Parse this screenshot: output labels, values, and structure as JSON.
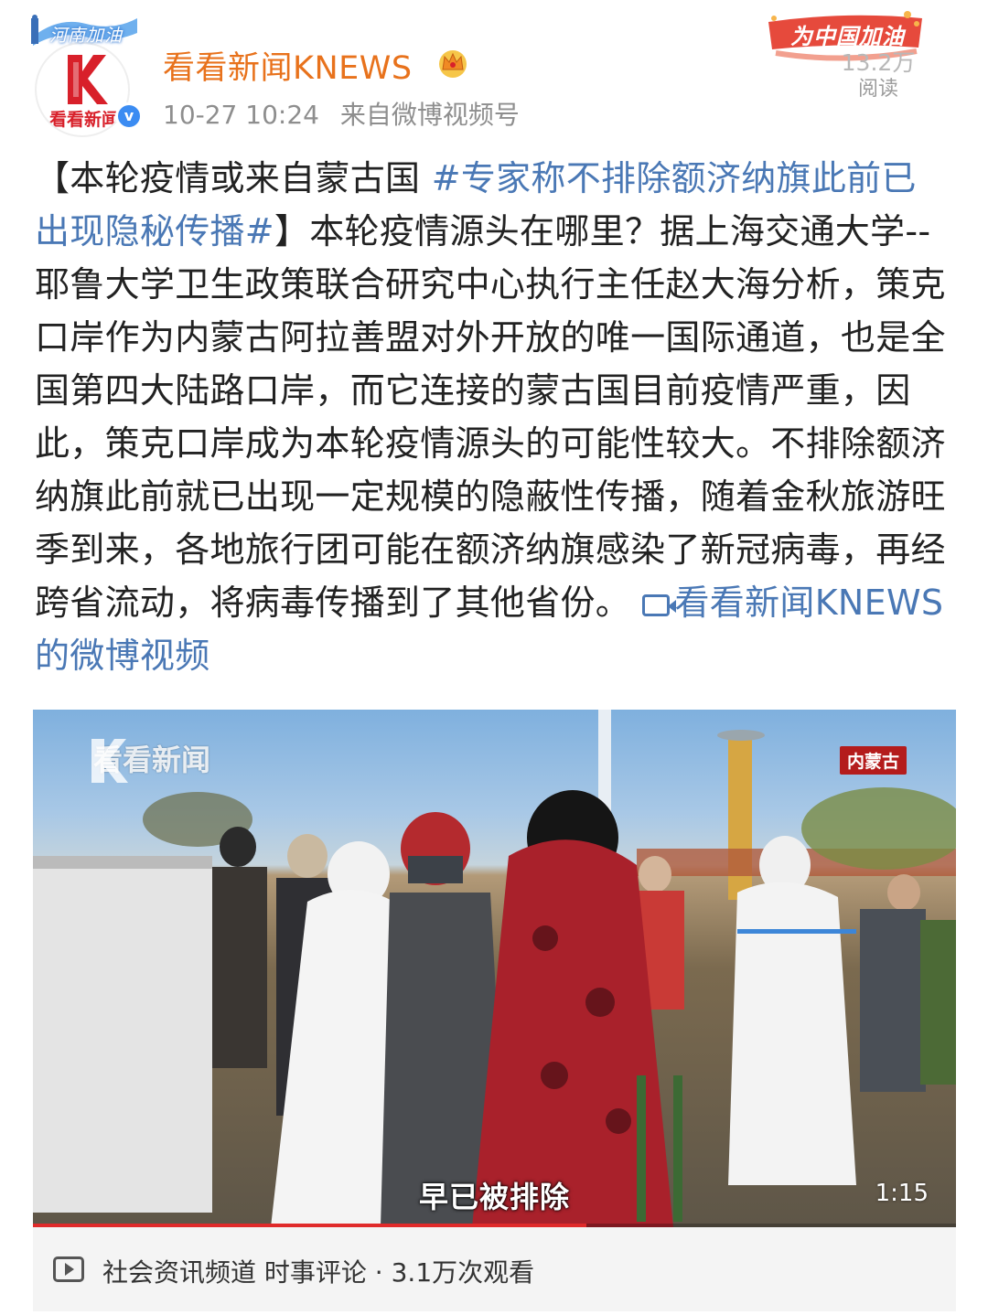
{
  "header": {
    "avatar_banner": "河南加油",
    "avatar_label": "看看新闻",
    "user_name": "看看新闻KNEWS",
    "timestamp": "10-27 10:24",
    "source_prefix": "来自",
    "source": "微博视频号",
    "campaign": "为中国加油",
    "reads_count": "13.2万",
    "reads_label": "阅读"
  },
  "post": {
    "p1": "【本轮疫情或来自蒙古国 ",
    "topic": "#专家称不排除额济纳旗此前已出现隐秘传播#",
    "p2": "】本轮疫情源头在哪里？据上海交通大学--耶鲁大学卫生政策联合研究中心执行主任赵大海分析，策克口岸作为内蒙古阿拉善盟对外开放的唯一国际通道，也是全国第四大陆路口岸，而它连接的蒙古国目前疫情严重，因此，策克口岸成为本轮疫情源头的可能性较大。不排除额济纳旗此前就已出现一定规模的隐蔽性传播，随着金秋旅游旺季到来，各地旅行团可能在额济纳旗感染了新冠病毒，再经跨省流动，将病毒传播到了其他省份。",
    "video_link": "看看新闻KNEWS的微博视频"
  },
  "video": {
    "watermark": "看看新闻",
    "location": "内蒙古",
    "subtitle": "早已被排除",
    "duration": "1:15",
    "progress": 0.6
  },
  "video_footer": {
    "text": "社会资讯频道 时事评论 · 3.1万次观看"
  },
  "colors": {
    "username": "#e8721c",
    "link": "#4a78b5",
    "meta": "#8e8e8e",
    "verified": "#3b8cf2",
    "brand_red": "#d8202a"
  }
}
